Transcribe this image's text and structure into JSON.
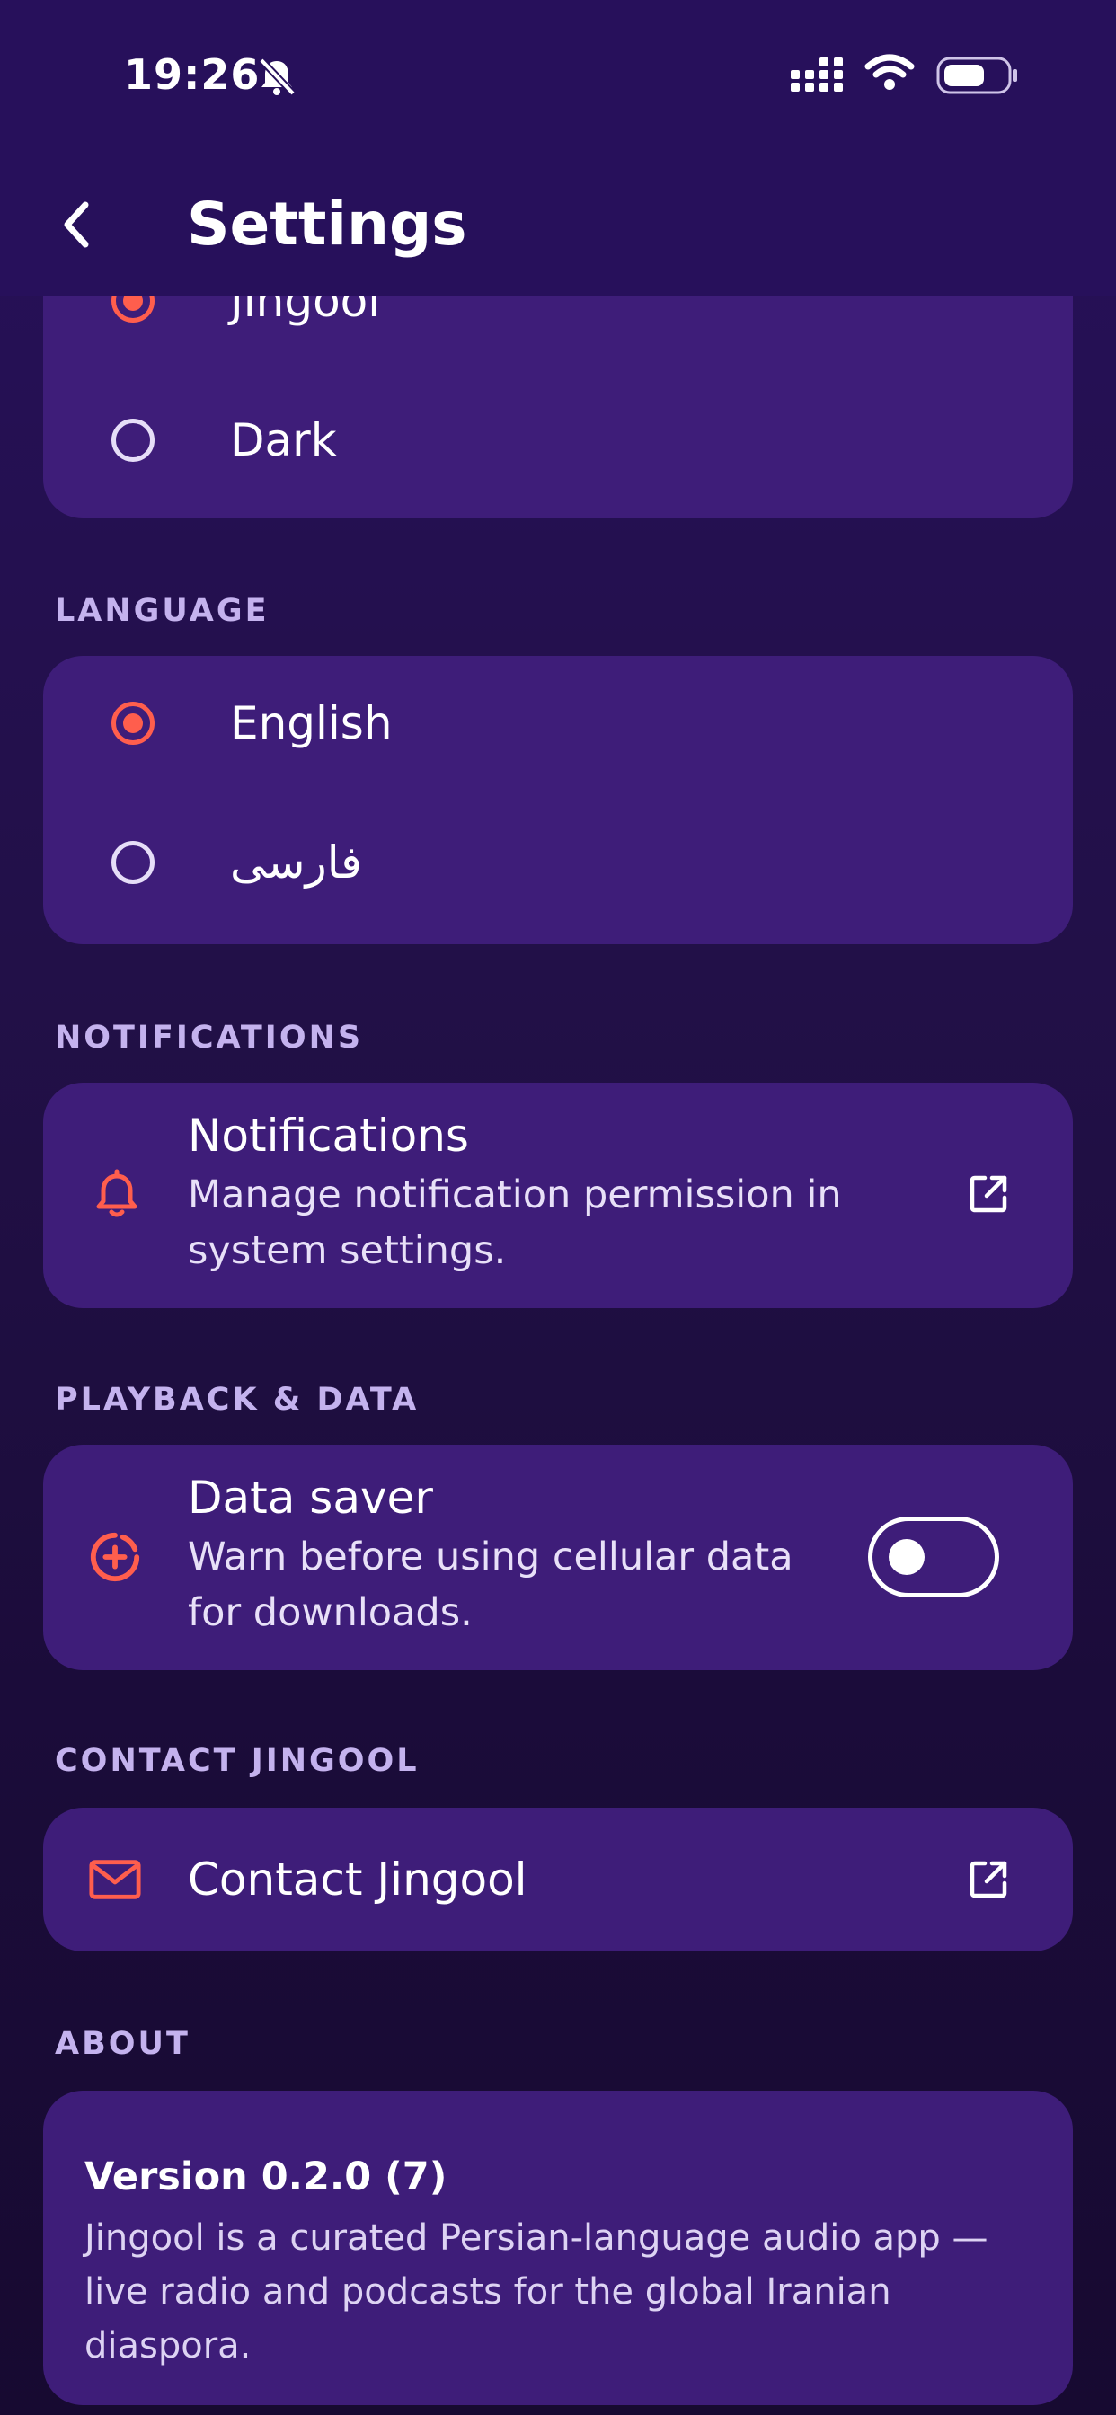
{
  "status_bar": {
    "time": "19:26"
  },
  "header": {
    "title": "Settings"
  },
  "theme": {
    "options": [
      {
        "label": "Jingool",
        "selected": true
      },
      {
        "label": "Dark",
        "selected": false
      }
    ]
  },
  "language": {
    "section_label": "LANGUAGE",
    "options": [
      {
        "label": "English",
        "selected": true
      },
      {
        "label": "فارسی",
        "selected": false
      }
    ]
  },
  "notifications": {
    "section_label": "NOTIFICATIONS",
    "title": "Notifications",
    "subtitle_line1": "Manage notification permission in",
    "subtitle_line2": "system settings."
  },
  "playback": {
    "section_label": "PLAYBACK & DATA",
    "title": "Data saver",
    "subtitle_line1": "Warn before using cellular data",
    "subtitle_line2": "for downloads.",
    "toggle_on": false
  },
  "contact": {
    "section_label": "CONTACT JINGOOL",
    "title": "Contact Jingool"
  },
  "about": {
    "section_label": "ABOUT",
    "version": "Version 0.2.0 (7)",
    "description": "Jingool is a curated Persian-language audio app — live radio and podcasts for the global Iranian diaspora."
  },
  "colors": {
    "background": "#27105b",
    "card": "#3e1d79",
    "accent": "#ff5e4d",
    "section_label": "#c4b2ee"
  },
  "icons": {
    "back": "chevron-left-icon",
    "notifications": "bell-icon",
    "data_saver": "data-saver-icon",
    "contact": "mail-icon",
    "external": "external-link-icon"
  }
}
